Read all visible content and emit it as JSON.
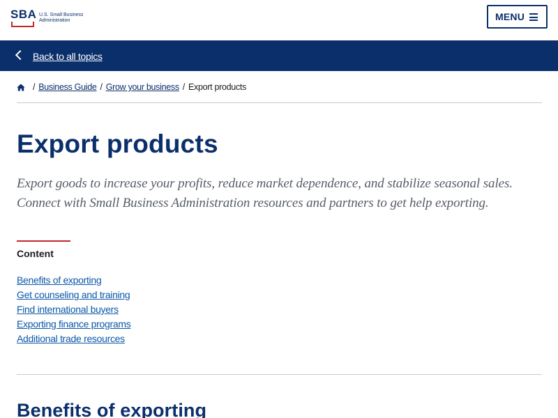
{
  "header": {
    "logo_text": "SBA",
    "logo_name": "U.S. Small Business Administration",
    "menu_label": "MENU"
  },
  "topic_bar": {
    "back_label": "Back to all topics"
  },
  "breadcrumb": {
    "home_icon": "home-icon",
    "items": [
      "Business Guide",
      "Grow your business"
    ],
    "current": "Export products",
    "separator": "/"
  },
  "page": {
    "title": "Export products",
    "lead": "Export goods to increase your profits, reduce market dependence, and stabilize seasonal sales. Connect with Small Business Administration resources and partners to get help exporting."
  },
  "toc": {
    "heading": "Content",
    "items": [
      "Benefits of exporting",
      "Get counseling and training",
      "Find international buyers",
      "Exporting finance programs",
      "Additional trade resources"
    ]
  },
  "section": {
    "title": "Benefits of exporting"
  },
  "colors": {
    "brand_navy": "#0b2f6b",
    "accent_red": "#c1272d",
    "link_blue": "#0b57a8",
    "lead_gray": "#565c65"
  }
}
